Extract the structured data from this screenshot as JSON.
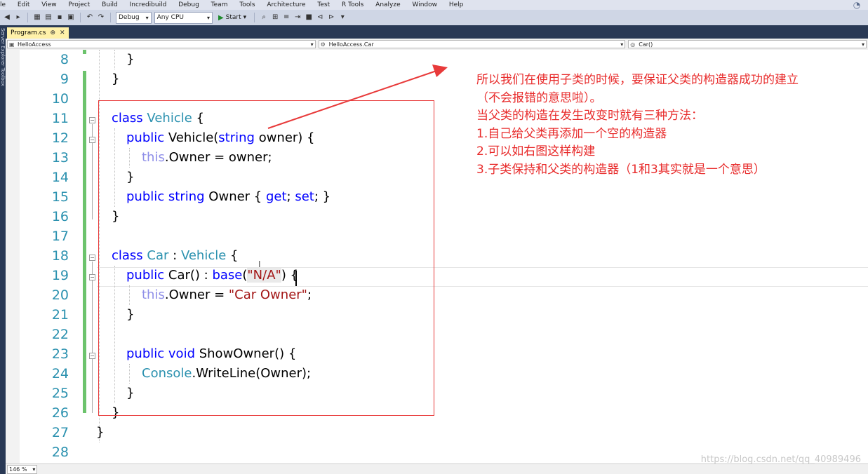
{
  "menu": [
    "le",
    "Edit",
    "View",
    "Project",
    "Build",
    "Incredibuild",
    "Debug",
    "Team",
    "Tools",
    "Architecture",
    "Test",
    "R Tools",
    "Analyze",
    "Window",
    "Help"
  ],
  "toolbar": {
    "config": "Debug",
    "platform": "Any CPU",
    "start_label": "Start"
  },
  "tab": {
    "label": "Program.cs",
    "pin": "⊕",
    "close": "✕"
  },
  "navbar": {
    "project": "HelloAccess",
    "type": "HelloAccess.Car",
    "member": "Car()"
  },
  "left_strip": "Server Explorer  Toolbox",
  "code_lines": [
    {
      "n": "8"
    },
    {
      "n": "9"
    },
    {
      "n": "10"
    },
    {
      "n": "11"
    },
    {
      "n": "12"
    },
    {
      "n": "13"
    },
    {
      "n": "14"
    },
    {
      "n": "15"
    },
    {
      "n": "16"
    },
    {
      "n": "17"
    },
    {
      "n": "18"
    },
    {
      "n": "19"
    },
    {
      "n": "20"
    },
    {
      "n": "21"
    },
    {
      "n": "22"
    },
    {
      "n": "23"
    },
    {
      "n": "24"
    },
    {
      "n": "25"
    },
    {
      "n": "26"
    },
    {
      "n": "27"
    },
    {
      "n": "28"
    }
  ],
  "code": {
    "l8": "}",
    "l9": "}",
    "l11": [
      "class",
      " ",
      "Vehicle",
      " {"
    ],
    "l12": [
      "public",
      " Vehicle(",
      "string",
      " owner) {"
    ],
    "l13": [
      "this",
      ".Owner = owner;"
    ],
    "l14": "}",
    "l15": [
      "public",
      " ",
      "string",
      " Owner { ",
      "get",
      "; ",
      "set",
      "; }"
    ],
    "l16": "}",
    "l18": [
      "class",
      " ",
      "Car",
      " : ",
      "Vehicle",
      " {"
    ],
    "l19": [
      "public",
      " Car() : ",
      "base",
      "(",
      "\"N/A\"",
      ") {"
    ],
    "l20": [
      "this",
      ".Owner = ",
      "\"Car Owner\"",
      ";"
    ],
    "l21": "}",
    "l23": [
      "public",
      " ",
      "void",
      " ShowOwner() {"
    ],
    "l24": [
      "Console",
      ".WriteLine(Owner);"
    ],
    "l25": "}",
    "l26": "}",
    "l27": "}"
  },
  "annotation": [
    "所以我们在使用子类的时候，要保证父类的构造器成功的建立",
    "（不会报错的意思啦）。",
    "当父类的构造在发生改变时就有三种方法：",
    "1.自己给父类再添加一个空的构造器",
    "2.可以如右图这样构建",
    "3.子类保持和父类的构造器（1和3其实就是一个意思）"
  ],
  "zoom": "146 %",
  "watermark": "https://blog.csdn.net/qq_40989496",
  "colors": {
    "keyword": "#0000ff",
    "type": "#2b91af",
    "string": "#a31515",
    "annotation": "#e82b2b",
    "line_number": "#2b91af"
  }
}
